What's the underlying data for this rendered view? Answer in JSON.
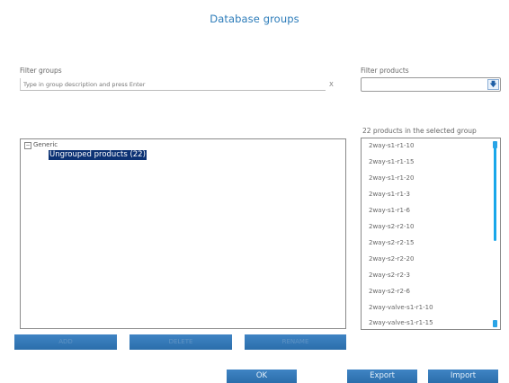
{
  "header": {
    "title": "Database groups"
  },
  "groups": {
    "filter_label": "Filter groups",
    "filter_placeholder": "Type in group description and press Enter",
    "clear_label": "X",
    "tree": {
      "toggle": "−",
      "root_label": "Generic",
      "selected_child": "Ungrouped products (22)"
    }
  },
  "products": {
    "filter_label": "Filter products",
    "count_text": "22   products in the selected group",
    "items": [
      "2way-s1-r1-10",
      "2way-s1-r1-15",
      "2way-s1-r1-20",
      "2way-s1-r1-3",
      "2way-s1-r1-6",
      "2way-s2-r2-10",
      "2way-s2-r2-15",
      "2way-s2-r2-20",
      "2way-s2-r2-3",
      "2way-s2-r2-6",
      "2way-valve-s1-r1-10",
      "2way-valve-s1-r1-15"
    ]
  },
  "actions": {
    "add": "ADD",
    "delete": "DELETE",
    "rename": "RENAME",
    "ok": "OK",
    "export": "Export",
    "import": "Import"
  },
  "colors": {
    "accent": "#2b6eab",
    "title": "#2b7bb9",
    "selection": "#0c3274",
    "scrollbar": "#19a7ea"
  },
  "icons": {
    "dropdown": "arrow-down-icon"
  }
}
